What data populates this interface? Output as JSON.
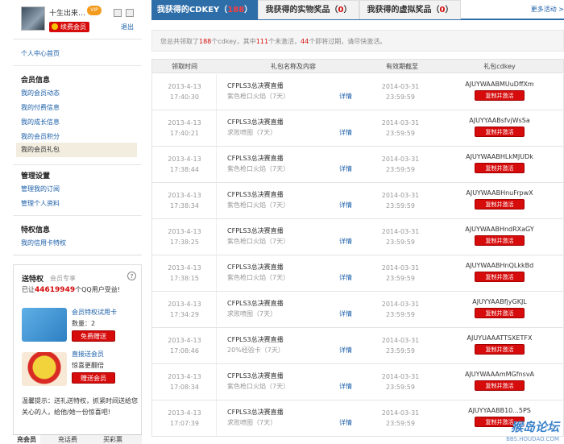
{
  "profile": {
    "username": "十生出来…",
    "member_badge": "续费会员",
    "logout": "退出"
  },
  "nav": {
    "home": "个人中心首页",
    "sections": [
      {
        "title": "会员信息",
        "items": [
          "我的会员动态",
          "我的付费信息",
          "我的成长信息",
          "我的会员积分",
          "我的会员礼包"
        ]
      },
      {
        "title": "管理设置",
        "items": [
          "管理我的订阅",
          "管理个人资料"
        ]
      },
      {
        "title": "特权信息",
        "items": [
          "我的信用卡特权"
        ]
      }
    ]
  },
  "promo": {
    "title": "送特权",
    "tag": "会员专享",
    "help": "?",
    "count_prefix": "已让",
    "count_value": "44619949",
    "count_suffix": "个QQ用户受益!",
    "card1_title": "会员特权试用卡",
    "card1_qty": "数量：2",
    "card1_btn": "免费赠送",
    "card2_title": "直接送会员",
    "card2_sub": "惊喜更翻倍",
    "card2_btn": "赠送会员",
    "tip": "温馨提示：送礼送特权，抓紧时间送给您关心的人，给他/她一份惊喜吧!"
  },
  "bottom_tabs": [
    "充会员",
    "充话费",
    "买彩票"
  ],
  "tabs": [
    {
      "label": "我获得的CDKEY",
      "count": "188"
    },
    {
      "label": "我获得的实物奖品",
      "count": "0"
    },
    {
      "label": "我获得的虚拟奖品",
      "count": "0"
    }
  ],
  "more_link": "更多活动 >",
  "notice": {
    "p1": "您总共领取了",
    "n1": "188",
    "p2": "个cdkey，其中",
    "n2": "111",
    "p3": "个未激活，",
    "n3": "44",
    "p4": "个即将过期，请尽快激活。"
  },
  "table": {
    "headers": [
      "领取时间",
      "礼包名称及内容",
      "有效期截至",
      "礼包cdkey"
    ],
    "detail_label": "详情",
    "copy_label": "复制并激活",
    "rows": [
      {
        "date": "2013-4-13",
        "time": "17:40:30",
        "name": "CFPLS3总决赛直播",
        "sub": "紫色枪口火焰（7天）",
        "exp_date": "2014-03-31",
        "exp_time": "23:59:59",
        "key": "AJUYWAABMUuDffXm"
      },
      {
        "date": "2013-4-13",
        "time": "17:40:21",
        "name": "CFPLS3总决赛直播",
        "sub": "求败喷图（7天）",
        "exp_date": "2014-03-31",
        "exp_time": "23:59:59",
        "key": "AJUYYAABsfvjWsSa"
      },
      {
        "date": "2013-4-13",
        "time": "17:38:44",
        "name": "CFPLS3总决赛直播",
        "sub": "紫色枪口火焰（7天）",
        "exp_date": "2014-03-31",
        "exp_time": "23:59:59",
        "key": "AJUYWAABHLkMJUDk"
      },
      {
        "date": "2013-4-13",
        "time": "17:38:34",
        "name": "CFPLS3总决赛直播",
        "sub": "紫色枪口火焰（7天）",
        "exp_date": "2014-03-31",
        "exp_time": "23:59:59",
        "key": "AJUYWAABHnuFrpwX"
      },
      {
        "date": "2013-4-13",
        "time": "17:38:25",
        "name": "CFPLS3总决赛直播",
        "sub": "紫色枪口火焰（7天）",
        "exp_date": "2014-03-31",
        "exp_time": "23:59:59",
        "key": "AJUYWAABHndRXaGY"
      },
      {
        "date": "2013-4-13",
        "time": "17:38:15",
        "name": "CFPLS3总决赛直播",
        "sub": "紫色枪口火焰（7天）",
        "exp_date": "2014-03-31",
        "exp_time": "23:59:59",
        "key": "AJUYWAABHnQLkkBd"
      },
      {
        "date": "2013-4-13",
        "time": "17:34:29",
        "name": "CFPLS3总决赛直播",
        "sub": "求败喷图（7天）",
        "exp_date": "2014-03-31",
        "exp_time": "23:59:59",
        "key": "AJUYYAABfjyGKJL"
      },
      {
        "date": "2013-4-13",
        "time": "17:08:46",
        "name": "CFPLS3总决赛直播",
        "sub": "20%经验卡（7天）",
        "exp_date": "2014-03-31",
        "exp_time": "23:59:59",
        "key": "AJUYUAAATTSXETFX"
      },
      {
        "date": "2013-4-13",
        "time": "17:08:34",
        "name": "CFPLS3总决赛直播",
        "sub": "紫色枪口火焰（7天）",
        "exp_date": "2014-03-31",
        "exp_time": "23:59:59",
        "key": "AJUYWAAAmMGfnsvA"
      },
      {
        "date": "2013-4-13",
        "time": "17:07:39",
        "name": "CFPLS3总决赛直播",
        "sub": "求败喷图（7天）",
        "exp_date": "2014-03-31",
        "exp_time": "23:59:59",
        "key": "AJUYYAABB10...5PS"
      }
    ]
  },
  "watermark": {
    "text": "猴岛论坛",
    "url": "BBS.HOUDAO.COM"
  }
}
